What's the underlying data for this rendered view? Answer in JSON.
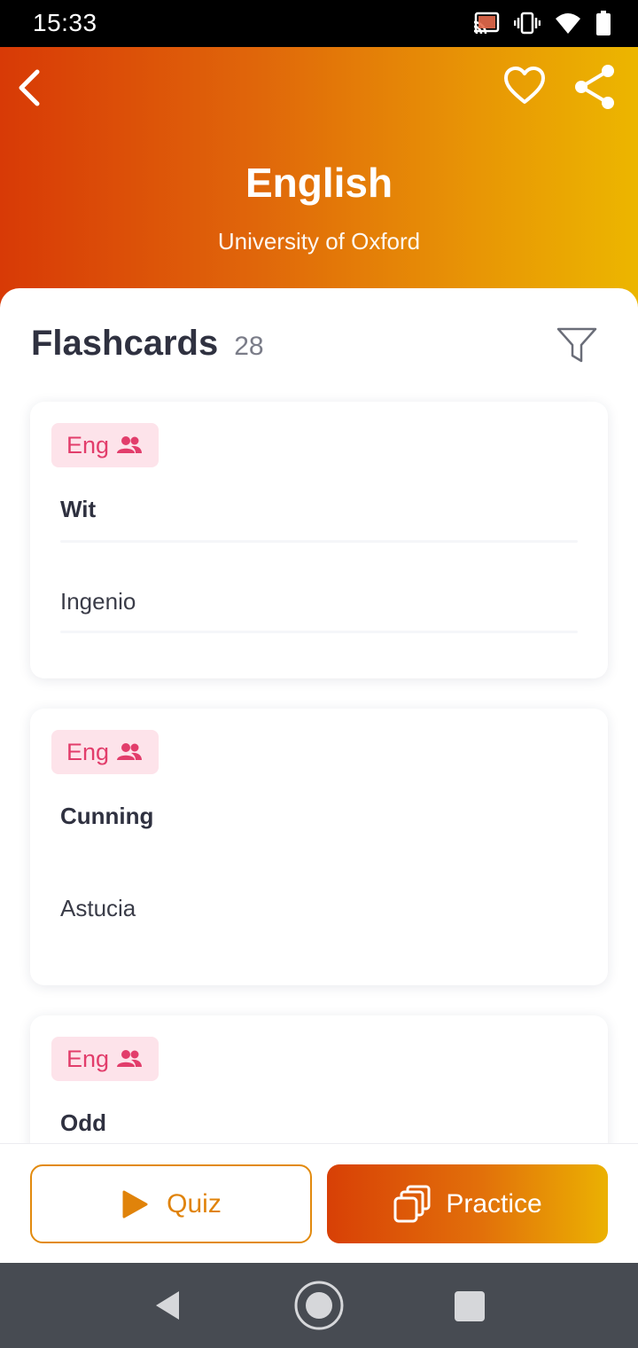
{
  "status_bar": {
    "time": "15:33",
    "icons": [
      "cast-icon",
      "vibrate-icon",
      "wifi-icon",
      "battery-icon"
    ]
  },
  "header": {
    "title": "English",
    "subtitle": "University of Oxford",
    "back_icon": "chevron-left-icon",
    "favorite_icon": "heart-icon",
    "share_icon": "share-icon",
    "gradient_start": "#d83a06",
    "gradient_end": "#ecb600"
  },
  "flashcards": {
    "title": "Flashcards",
    "count": "28",
    "filter_icon": "filter-icon",
    "cards": [
      {
        "badge": "Eng",
        "term": "Wit",
        "definition": "Ingenio"
      },
      {
        "badge": "Eng",
        "term": "Cunning",
        "definition": "Astucia"
      },
      {
        "badge": "Eng",
        "term": "Odd",
        "definition": ""
      }
    ]
  },
  "actions": {
    "quiz_label": "Quiz",
    "practice_label": "Practice",
    "accent": "#e28a0e",
    "badge_color": "#e23d6b"
  },
  "nav": {
    "icons": [
      "nav-back-icon",
      "nav-home-icon",
      "nav-recent-icon"
    ]
  }
}
